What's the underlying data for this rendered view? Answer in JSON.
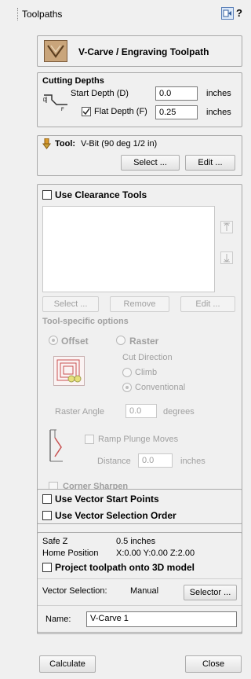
{
  "header": {
    "title": "Toolpaths",
    "help_label": "?"
  },
  "toolpath_banner": {
    "title": "V-Carve / Engraving Toolpath"
  },
  "cutting_depths": {
    "heading": "Cutting Depths",
    "start_depth_label": "Start Depth (D)",
    "start_depth_value": "0.0",
    "start_depth_unit": "inches",
    "flat_depth_label": "Flat Depth (F)",
    "flat_depth_value": "0.25",
    "flat_depth_unit": "inches",
    "flat_depth_checked": true
  },
  "tool": {
    "label": "Tool:",
    "value": "V-Bit (90 deg 1/2 in)",
    "select_label": "Select ...",
    "edit_label": "Edit ..."
  },
  "clearance": {
    "label": "Use Clearance Tools",
    "checked": false,
    "select_label": "Select ...",
    "remove_label": "Remove",
    "edit_label": "Edit ...",
    "options_heading": "Tool-specific options",
    "offset_label": "Offset",
    "raster_label": "Raster",
    "cut_direction_label": "Cut Direction",
    "climb_label": "Climb",
    "conventional_label": "Conventional",
    "raster_angle_label": "Raster Angle",
    "raster_angle_value": "0.0",
    "raster_angle_unit": "degrees",
    "ramp_label": "Ramp Plunge Moves",
    "distance_label": "Distance",
    "distance_value": "0.0",
    "distance_unit": "inches",
    "corner_sharpen_label": "Corner Sharpen"
  },
  "vector_options": {
    "start_points_label": "Use Vector Start Points",
    "selection_order_label": "Use Vector Selection Order"
  },
  "info": {
    "safe_z_label": "Safe Z",
    "safe_z_value": "0.5 inches",
    "home_label": "Home Position",
    "home_value": "X:0.00 Y:0.00 Z:2.00",
    "project_label": "Project toolpath onto 3D model",
    "vector_selection_label": "Vector Selection:",
    "vector_selection_value": "Manual",
    "selector_label": "Selector ...",
    "name_label": "Name:",
    "name_value": "V-Carve 1"
  },
  "footer": {
    "calculate_label": "Calculate",
    "close_label": "Close"
  }
}
